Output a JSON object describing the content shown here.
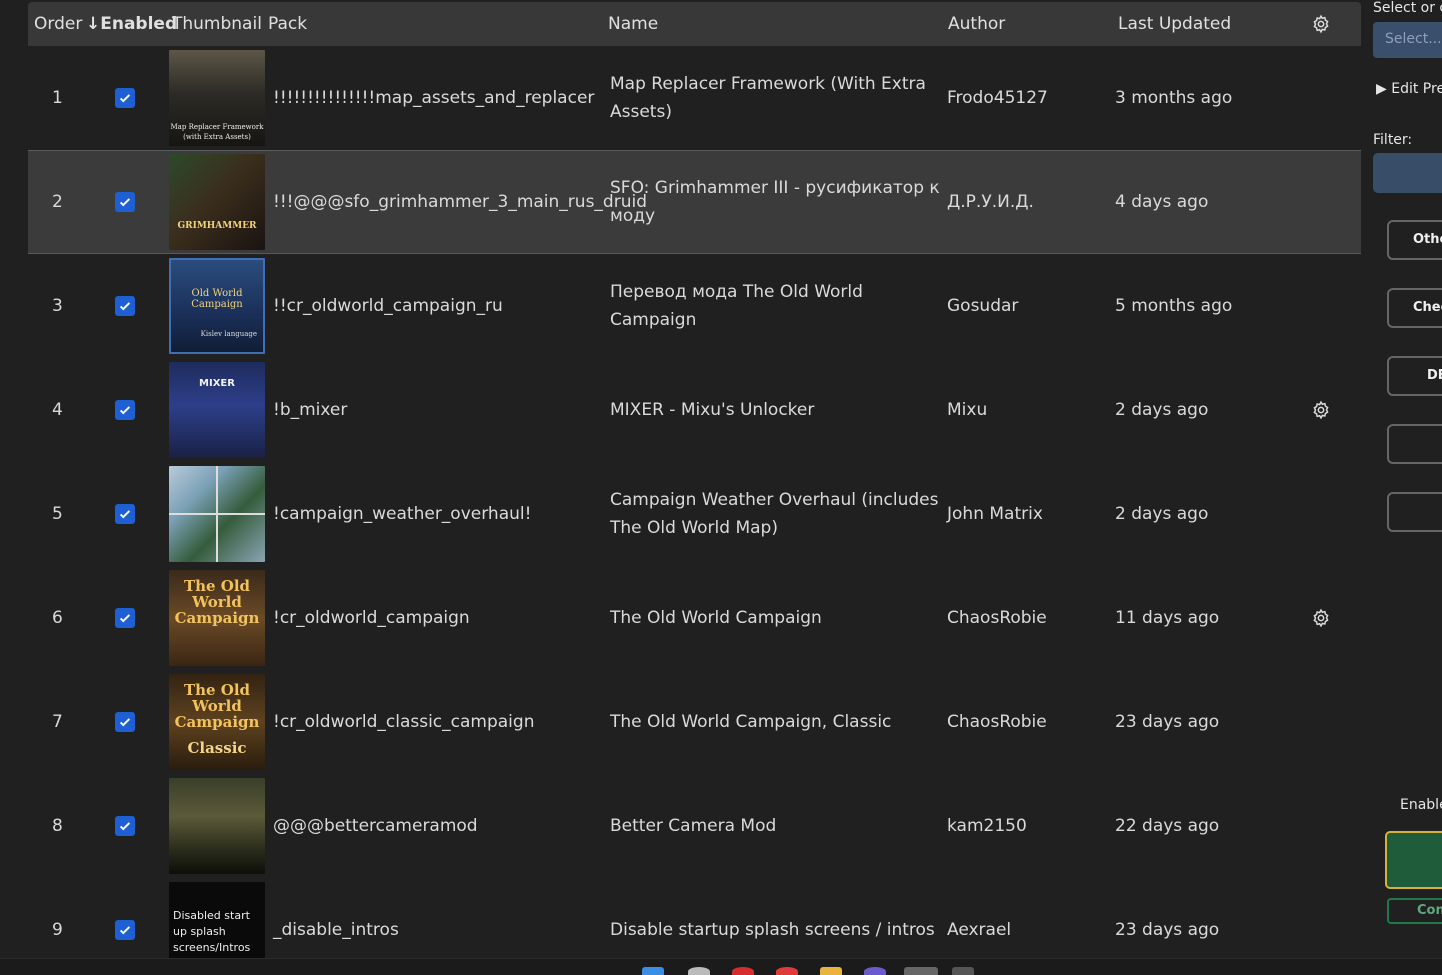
{
  "table": {
    "headers": {
      "order": "Order",
      "enabled": "Enabled",
      "sort_arrow": "↓",
      "thumbnail": "Thumbnail",
      "pack": "Pack",
      "name": "Name",
      "author": "Author",
      "last_updated": "Last Updated"
    },
    "rows": [
      {
        "order": "1",
        "enabled": true,
        "pack": "!!!!!!!!!!!!!!!map_assets_and_replacer",
        "name": "Map Replacer Framework (With Extra Assets)",
        "author": "Frodo45127",
        "updated": "3 months ago",
        "thumb_text": "Map Replacer Framework (with Extra Assets)",
        "has_gear": false
      },
      {
        "order": "2",
        "enabled": true,
        "pack": "!!!@@@sfo_grimhammer_3_main_rus_druid",
        "name": "SFO: Grimhammer III - русификатор к моду",
        "author": "Д.Р.У.И.Д.",
        "updated": "4 days ago",
        "thumb_text": "GRIMHAMMER",
        "has_gear": false,
        "selected": true
      },
      {
        "order": "3",
        "enabled": true,
        "pack": "!!cr_oldworld_campaign_ru",
        "name": "Перевод мода The Old World Campaign",
        "author": "Gosudar",
        "updated": "5 months ago",
        "thumb_text": "Old World Campaign",
        "thumb_sub": "Kislev language",
        "has_gear": false
      },
      {
        "order": "4",
        "enabled": true,
        "pack": "!b_mixer",
        "name": "MIXER - Mixu's Unlocker",
        "author": "Mixu",
        "updated": "2 days ago",
        "thumb_text": "MIXER",
        "has_gear": true
      },
      {
        "order": "5",
        "enabled": true,
        "pack": "!campaign_weather_overhaul!",
        "name": "Campaign Weather Overhaul (includes The Old World Map)",
        "author": "John Matrix",
        "updated": "2 days ago",
        "thumb_text": "",
        "has_gear": false
      },
      {
        "order": "6",
        "enabled": true,
        "pack": "!cr_oldworld_campaign",
        "name": "The Old World Campaign",
        "author": "ChaosRobie",
        "updated": "11 days ago",
        "thumb_text": "The Old World Campaign",
        "has_gear": true
      },
      {
        "order": "7",
        "enabled": true,
        "pack": "!cr_oldworld_classic_campaign",
        "name": "The Old World Campaign, Classic",
        "author": "ChaosRobie",
        "updated": "23 days ago",
        "thumb_text": "The Old World Campaign",
        "thumb_sub": "Classic",
        "has_gear": false
      },
      {
        "order": "8",
        "enabled": true,
        "pack": "@@@bettercameramod",
        "name": "Better Camera Mod",
        "author": "kam2150",
        "updated": "22 days ago",
        "thumb_text": "",
        "has_gear": false
      },
      {
        "order": "9",
        "enabled": true,
        "pack": "_disable_intros",
        "name": "Disable startup splash screens / intros",
        "author": "Aexrael",
        "updated": "23 days ago",
        "thumb_text": "Disabled start up splash screens/Intros",
        "has_gear": false
      }
    ]
  },
  "right_panel": {
    "select_label": "Select or c",
    "select_placeholder": "Select...",
    "edit_preset": "Edit Pre",
    "filter_label": "Filter:",
    "buttons": [
      "Othe",
      "Chec",
      "DE",
      "",
      ""
    ],
    "enabled_label": "Enable",
    "con_button": "Con"
  },
  "colors": {
    "background": "#202020",
    "header": "#383838",
    "checkbox": "#1e5fd4",
    "selected_row": "#3b3b3b",
    "accent_gold": "#d7b13a",
    "accent_green": "#1f5c3a"
  }
}
